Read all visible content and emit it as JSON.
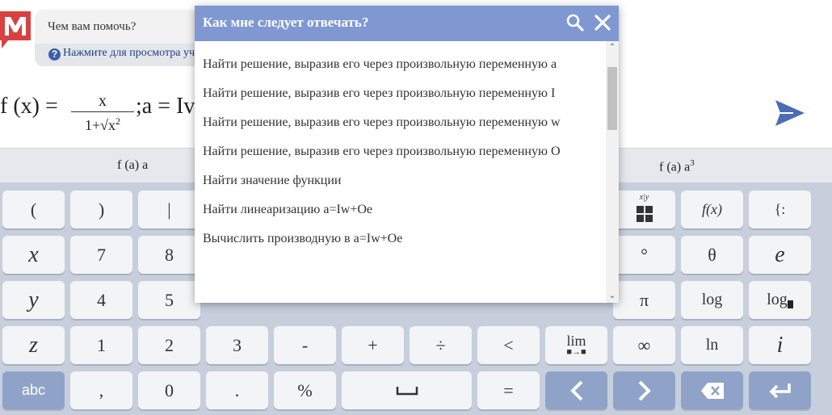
{
  "help": {
    "question": "Чем вам помочь?",
    "hint": "Нажмите для просмотра уч"
  },
  "expression": {
    "lhs": "f (x) = ",
    "numerator": "x",
    "denominator": "1+√x",
    "den_exponent": "2",
    "tail": ";a = Iv"
  },
  "suggestions": {
    "left": "f (a) a",
    "right": "f (a) a",
    "right_exponent": "3"
  },
  "modal": {
    "title": "Как мне следует отвечать?",
    "options": [
      "Найти решение, выразив его через произвольную переменную a",
      "Найти решение, выразив его через произвольную переменную I",
      "Найти решение, выразив его через произвольную переменную w",
      "Найти решение, выразив его через произвольную переменную O",
      "Найти значение функции",
      "Найти линеаризацию a=Iw+Oe",
      "Вычислить производную в a=Iw+Oe"
    ]
  },
  "keyboard": {
    "row1": [
      "(",
      ")",
      "|"
    ],
    "row1_right": [
      "x|y",
      "f(x)",
      "{:"
    ],
    "row2": [
      "x",
      "7",
      "8"
    ],
    "row2_right": [
      "°",
      "θ",
      "e"
    ],
    "row3": [
      "y",
      "4",
      "5"
    ],
    "row3_right": [
      "π",
      "log",
      "log"
    ],
    "row4": [
      "z",
      "1",
      "2",
      "3",
      "-",
      "+",
      "÷",
      "<",
      "lim",
      "∞",
      "ln",
      "i"
    ],
    "row5": [
      "abc",
      ",",
      "0",
      ".",
      "%",
      "␣",
      "=",
      "‹",
      "›",
      "⌫",
      "↵"
    ]
  },
  "colors": {
    "modal_header": "#7f98d2",
    "keyboard_bg": "#c7cfdd",
    "dark_key": "#8fa3c8",
    "send_icon": "#4a6db5"
  }
}
